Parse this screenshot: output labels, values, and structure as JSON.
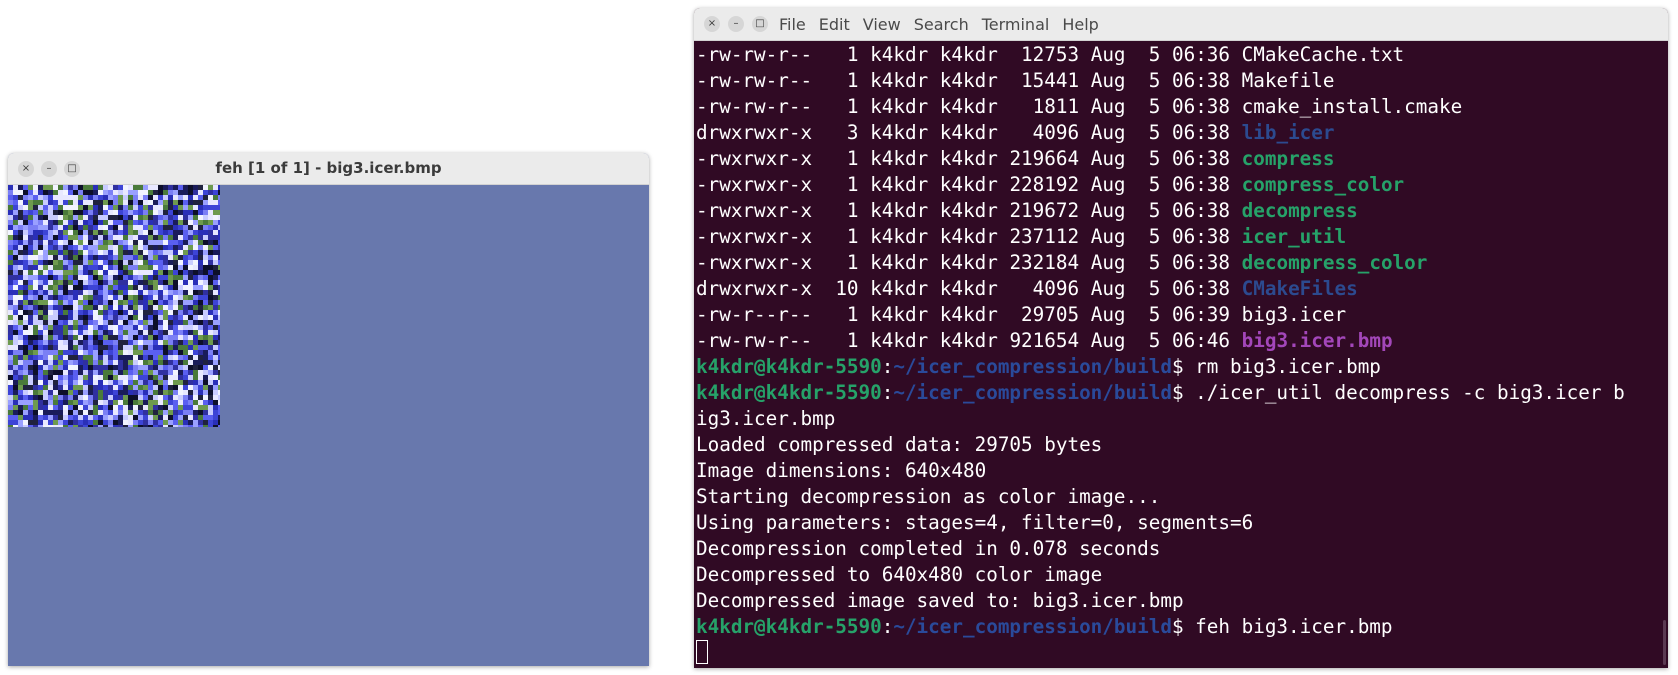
{
  "feh_window": {
    "title": "feh [1 of 1] - big3.icer.bmp",
    "close_glyph": "×",
    "minimize_glyph": "–",
    "maximize_glyph": "□",
    "background_color": "#6878ad"
  },
  "terminal": {
    "close_glyph": "×",
    "minimize_glyph": "–",
    "maximize_glyph": "□",
    "menu": [
      "File",
      "Edit",
      "View",
      "Search",
      "Terminal",
      "Help"
    ],
    "listing": [
      {
        "perms": "-rw-rw-r-- ",
        "links": " 1",
        "owner": "k4kdr",
        "group": "k4kdr",
        "size": " 12753",
        "month": "Aug",
        "day": " 5",
        "time": "06:36",
        "name": "CMakeCache.txt",
        "kind": "file"
      },
      {
        "perms": "-rw-rw-r-- ",
        "links": " 1",
        "owner": "k4kdr",
        "group": "k4kdr",
        "size": " 15441",
        "month": "Aug",
        "day": " 5",
        "time": "06:38",
        "name": "Makefile",
        "kind": "file"
      },
      {
        "perms": "-rw-rw-r-- ",
        "links": " 1",
        "owner": "k4kdr",
        "group": "k4kdr",
        "size": "  1811",
        "month": "Aug",
        "day": " 5",
        "time": "06:38",
        "name": "cmake_install.cmake",
        "kind": "file"
      },
      {
        "perms": "drwxrwxr-x ",
        "links": " 3",
        "owner": "k4kdr",
        "group": "k4kdr",
        "size": "  4096",
        "month": "Aug",
        "day": " 5",
        "time": "06:38",
        "name": "lib_icer",
        "kind": "dir"
      },
      {
        "perms": "-rwxrwxr-x ",
        "links": " 1",
        "owner": "k4kdr",
        "group": "k4kdr",
        "size": "219664",
        "month": "Aug",
        "day": " 5",
        "time": "06:38",
        "name": "compress",
        "kind": "exec"
      },
      {
        "perms": "-rwxrwxr-x ",
        "links": " 1",
        "owner": "k4kdr",
        "group": "k4kdr",
        "size": "228192",
        "month": "Aug",
        "day": " 5",
        "time": "06:38",
        "name": "compress_color",
        "kind": "exec"
      },
      {
        "perms": "-rwxrwxr-x ",
        "links": " 1",
        "owner": "k4kdr",
        "group": "k4kdr",
        "size": "219672",
        "month": "Aug",
        "day": " 5",
        "time": "06:38",
        "name": "decompress",
        "kind": "exec"
      },
      {
        "perms": "-rwxrwxr-x ",
        "links": " 1",
        "owner": "k4kdr",
        "group": "k4kdr",
        "size": "237112",
        "month": "Aug",
        "day": " 5",
        "time": "06:38",
        "name": "icer_util",
        "kind": "exec"
      },
      {
        "perms": "-rwxrwxr-x ",
        "links": " 1",
        "owner": "k4kdr",
        "group": "k4kdr",
        "size": "232184",
        "month": "Aug",
        "day": " 5",
        "time": "06:38",
        "name": "decompress_color",
        "kind": "exec"
      },
      {
        "perms": "drwxrwxr-x ",
        "links": "10",
        "owner": "k4kdr",
        "group": "k4kdr",
        "size": "  4096",
        "month": "Aug",
        "day": " 5",
        "time": "06:38",
        "name": "CMakeFiles",
        "kind": "dir"
      },
      {
        "perms": "-rw-r--r-- ",
        "links": " 1",
        "owner": "k4kdr",
        "group": "k4kdr",
        "size": " 29705",
        "month": "Aug",
        "day": " 5",
        "time": "06:39",
        "name": "big3.icer",
        "kind": "file"
      },
      {
        "perms": "-rw-rw-r-- ",
        "links": " 1",
        "owner": "k4kdr",
        "group": "k4kdr",
        "size": "921654",
        "month": "Aug",
        "day": " 5",
        "time": "06:46",
        "name": "big3.icer.bmp",
        "kind": "image"
      }
    ],
    "prompt": {
      "user_host": "k4kdr@k4kdr-5590",
      "colon": ":",
      "path": "~/icer_compression/build",
      "dollar": "$ "
    },
    "commands": {
      "rm": "rm big3.icer.bmp",
      "decompress_part1": "./icer_util decompress -c big3.icer b",
      "decompress_part2": "ig3.icer.bmp",
      "feh": "feh big3.icer.bmp"
    },
    "output": [
      "Loaded compressed data: 29705 bytes",
      "Image dimensions: 640x480",
      "Starting decompression as color image...",
      "Using parameters: stages=4, filter=0, segments=6",
      "Decompression completed in 0.078 seconds",
      "Decompressed to 640x480 color image",
      "Decompressed image saved to: big3.icer.bmp"
    ],
    "colors": {
      "background": "#300a24",
      "dir": "#2c4a8f",
      "exec": "#26a269",
      "image": "#a347ba",
      "prompt_host": "#26a269",
      "prompt_path": "#2a4a9a"
    }
  }
}
